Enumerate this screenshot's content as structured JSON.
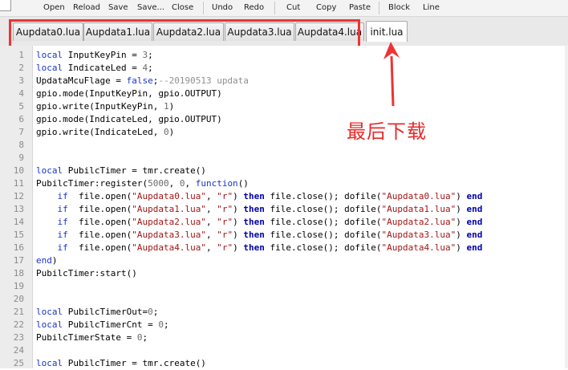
{
  "toolbar": {
    "open": "Open",
    "reload": "Reload",
    "save": "Save",
    "save_as": "Save...",
    "close": "Close",
    "undo": "Undo",
    "redo": "Redo",
    "cut": "Cut",
    "copy": "Copy",
    "paste": "Paste",
    "block": "Block",
    "line": "Line"
  },
  "tabs": [
    {
      "label": "Aupdata0.lua"
    },
    {
      "label": "Aupdata1.lua"
    },
    {
      "label": "Aupdata2.lua"
    },
    {
      "label": "Aupdata3.lua"
    },
    {
      "label": "Aupdata4.lua"
    },
    {
      "label": "init.lua",
      "active": true
    }
  ],
  "annotation": {
    "text": "最后下载",
    "color": "#e52b2b"
  },
  "editor": {
    "line_numbers": [
      "1",
      "2",
      "3",
      "4",
      "5",
      "6",
      "7",
      "8",
      "9",
      "10",
      "11",
      "12",
      "13",
      "14",
      "15",
      "16",
      "17",
      "18",
      "19",
      "20",
      "21",
      "22",
      "23",
      "24",
      "25"
    ],
    "lines": [
      [
        {
          "t": "local",
          "c": "kw"
        },
        {
          "t": " InputKeyPin = "
        },
        {
          "t": "3",
          "c": "num"
        },
        {
          "t": ";"
        }
      ],
      [
        {
          "t": "local",
          "c": "kw"
        },
        {
          "t": " IndicateLed = "
        },
        {
          "t": "4",
          "c": "num"
        },
        {
          "t": ";"
        }
      ],
      [
        {
          "t": "UpdataMcuFlage = "
        },
        {
          "t": "false",
          "c": "kw"
        },
        {
          "t": ";"
        },
        {
          "t": "--20190513 updata",
          "c": "cm"
        }
      ],
      [
        {
          "t": "gpio.mode(InputKeyPin, gpio.OUTPUT)"
        }
      ],
      [
        {
          "t": "gpio.write(InputKeyPin, "
        },
        {
          "t": "1",
          "c": "num"
        },
        {
          "t": ")"
        }
      ],
      [
        {
          "t": "gpio.mode(IndicateLed, gpio.OUTPUT)"
        }
      ],
      [
        {
          "t": "gpio.write(IndicateLed, "
        },
        {
          "t": "0",
          "c": "num"
        },
        {
          "t": ")"
        }
      ],
      [],
      [],
      [
        {
          "t": "local",
          "c": "kw"
        },
        {
          "t": " PubilcTimer = tmr.create()"
        }
      ],
      [
        {
          "t": "PubilcTimer:register("
        },
        {
          "t": "5000",
          "c": "num"
        },
        {
          "t": ", "
        },
        {
          "t": "0",
          "c": "num"
        },
        {
          "t": ", "
        },
        {
          "t": "function",
          "c": "kw"
        },
        {
          "t": "()"
        }
      ],
      [
        {
          "t": "    "
        },
        {
          "t": "if",
          "c": "kw"
        },
        {
          "t": "  file.open("
        },
        {
          "t": "\"Aupdata0.lua\"",
          "c": "str"
        },
        {
          "t": ", "
        },
        {
          "t": "\"r\"",
          "c": "str"
        },
        {
          "t": ") "
        },
        {
          "t": "then",
          "c": "kw2"
        },
        {
          "t": " file.close(); dofile("
        },
        {
          "t": "\"Aupdata0.lua\"",
          "c": "str"
        },
        {
          "t": ") "
        },
        {
          "t": "end",
          "c": "kw2"
        }
      ],
      [
        {
          "t": "    "
        },
        {
          "t": "if",
          "c": "kw"
        },
        {
          "t": "  file.open("
        },
        {
          "t": "\"Aupdata1.lua\"",
          "c": "str"
        },
        {
          "t": ", "
        },
        {
          "t": "\"r\"",
          "c": "str"
        },
        {
          "t": ") "
        },
        {
          "t": "then",
          "c": "kw2"
        },
        {
          "t": " file.close(); dofile("
        },
        {
          "t": "\"Aupdata1.lua\"",
          "c": "str"
        },
        {
          "t": ") "
        },
        {
          "t": "end",
          "c": "kw2"
        }
      ],
      [
        {
          "t": "    "
        },
        {
          "t": "if",
          "c": "kw"
        },
        {
          "t": "  file.open("
        },
        {
          "t": "\"Aupdata2.lua\"",
          "c": "str"
        },
        {
          "t": ", "
        },
        {
          "t": "\"r\"",
          "c": "str"
        },
        {
          "t": ") "
        },
        {
          "t": "then",
          "c": "kw2"
        },
        {
          "t": " file.close(); dofile("
        },
        {
          "t": "\"Aupdata2.lua\"",
          "c": "str"
        },
        {
          "t": ") "
        },
        {
          "t": "end",
          "c": "kw2"
        }
      ],
      [
        {
          "t": "    "
        },
        {
          "t": "if",
          "c": "kw"
        },
        {
          "t": "  file.open("
        },
        {
          "t": "\"Aupdata3.lua\"",
          "c": "str"
        },
        {
          "t": ", "
        },
        {
          "t": "\"r\"",
          "c": "str"
        },
        {
          "t": ") "
        },
        {
          "t": "then",
          "c": "kw2"
        },
        {
          "t": " file.close(); dofile("
        },
        {
          "t": "\"Aupdata3.lua\"",
          "c": "str"
        },
        {
          "t": ") "
        },
        {
          "t": "end",
          "c": "kw2"
        }
      ],
      [
        {
          "t": "    "
        },
        {
          "t": "if",
          "c": "kw"
        },
        {
          "t": "  file.open("
        },
        {
          "t": "\"Aupdata4.lua\"",
          "c": "str"
        },
        {
          "t": ", "
        },
        {
          "t": "\"r\"",
          "c": "str"
        },
        {
          "t": ") "
        },
        {
          "t": "then",
          "c": "kw2"
        },
        {
          "t": " file.close(); dofile("
        },
        {
          "t": "\"Aupdata4.lua\"",
          "c": "str"
        },
        {
          "t": ") "
        },
        {
          "t": "end",
          "c": "kw2"
        }
      ],
      [
        {
          "t": "end",
          "c": "kw"
        },
        {
          "t": ")"
        }
      ],
      [
        {
          "t": "PubilcTimer:start()"
        }
      ],
      [],
      [],
      [
        {
          "t": "local",
          "c": "kw"
        },
        {
          "t": " PubilcTimerOut="
        },
        {
          "t": "0",
          "c": "num"
        },
        {
          "t": ";"
        }
      ],
      [
        {
          "t": "local",
          "c": "kw"
        },
        {
          "t": " PubilcTimerCnt = "
        },
        {
          "t": "0",
          "c": "num"
        },
        {
          "t": ";"
        }
      ],
      [
        {
          "t": "PubilcTimerState = "
        },
        {
          "t": "0",
          "c": "num"
        },
        {
          "t": ";"
        }
      ],
      [],
      [
        {
          "t": "local",
          "c": "kw"
        },
        {
          "t": " PubilcTimer = tmr.create()"
        }
      ]
    ]
  }
}
